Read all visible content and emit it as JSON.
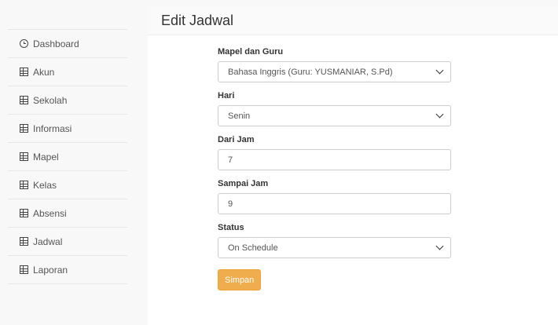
{
  "sidebar": {
    "items": [
      {
        "label": "Dashboard",
        "icon": "clock-icon"
      },
      {
        "label": "Akun",
        "icon": "grid-icon"
      },
      {
        "label": "Sekolah",
        "icon": "grid-icon"
      },
      {
        "label": "Informasi",
        "icon": "grid-icon"
      },
      {
        "label": "Mapel",
        "icon": "grid-icon"
      },
      {
        "label": "Kelas",
        "icon": "grid-icon"
      },
      {
        "label": "Absensi",
        "icon": "grid-icon"
      },
      {
        "label": "Jadwal",
        "icon": "grid-icon"
      },
      {
        "label": "Laporan",
        "icon": "grid-icon"
      }
    ]
  },
  "page": {
    "title": "Edit Jadwal"
  },
  "form": {
    "mapel_label": "Mapel dan Guru",
    "mapel_value": "Bahasa Inggris (Guru: YUSMANIAR, S.Pd)",
    "hari_label": "Hari",
    "hari_value": "Senin",
    "dari_label": "Dari Jam",
    "dari_value": "7",
    "sampai_label": "Sampai Jam",
    "sampai_value": "9",
    "status_label": "Status",
    "status_value": "On Schedule",
    "save_label": "Simpan"
  },
  "colors": {
    "accent_button": "#f0ad4e",
    "link": "#337ab7"
  }
}
